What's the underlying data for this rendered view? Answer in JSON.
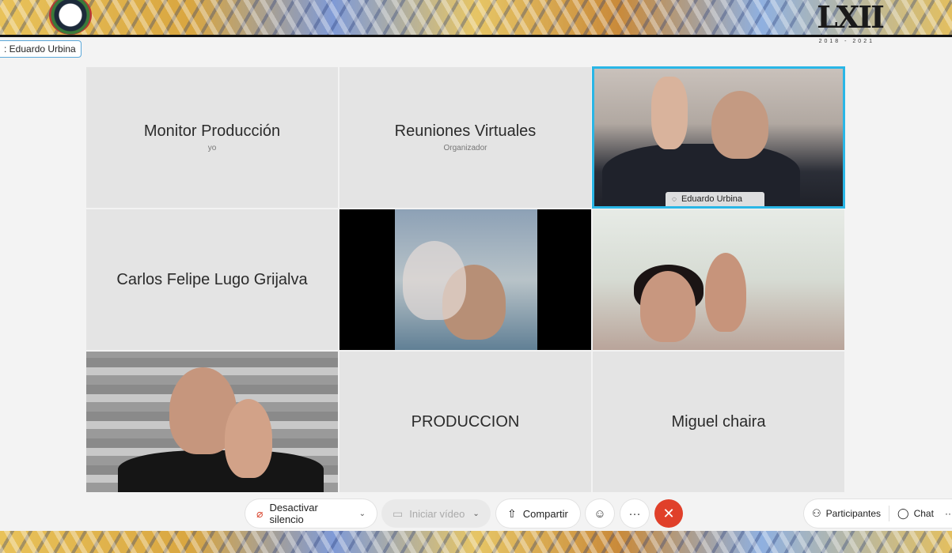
{
  "speaker_tag": ": Eduardo Urbina",
  "logo_text": "LXII",
  "logo_years": "2018 - 2021",
  "tiles": [
    {
      "name": "Monitor Producción",
      "role": "yo"
    },
    {
      "name": "Reuniones Virtuales",
      "role": "Organizador"
    },
    {
      "name": "Eduardo Urbina",
      "video": true
    },
    {
      "name": "Carlos Felipe Lugo Grijalva",
      "role": ""
    },
    {
      "name": "",
      "video": true
    },
    {
      "name": "",
      "video": true
    },
    {
      "name": "",
      "video": true
    },
    {
      "name": "PRODUCCION",
      "role": ""
    },
    {
      "name": "Miguel chaira",
      "role": ""
    }
  ],
  "toolbar": {
    "mute_label": "Desactivar silencio",
    "video_label": "Iniciar vídeo",
    "share_label": "Compartir",
    "more_label": "···",
    "end_label": "✕"
  },
  "right_panel": {
    "participants_label": "Participantes",
    "chat_label": "Chat",
    "overflow_label": "···"
  },
  "colors": {
    "active_border": "#29b6e6",
    "end_button": "#e0402a"
  }
}
